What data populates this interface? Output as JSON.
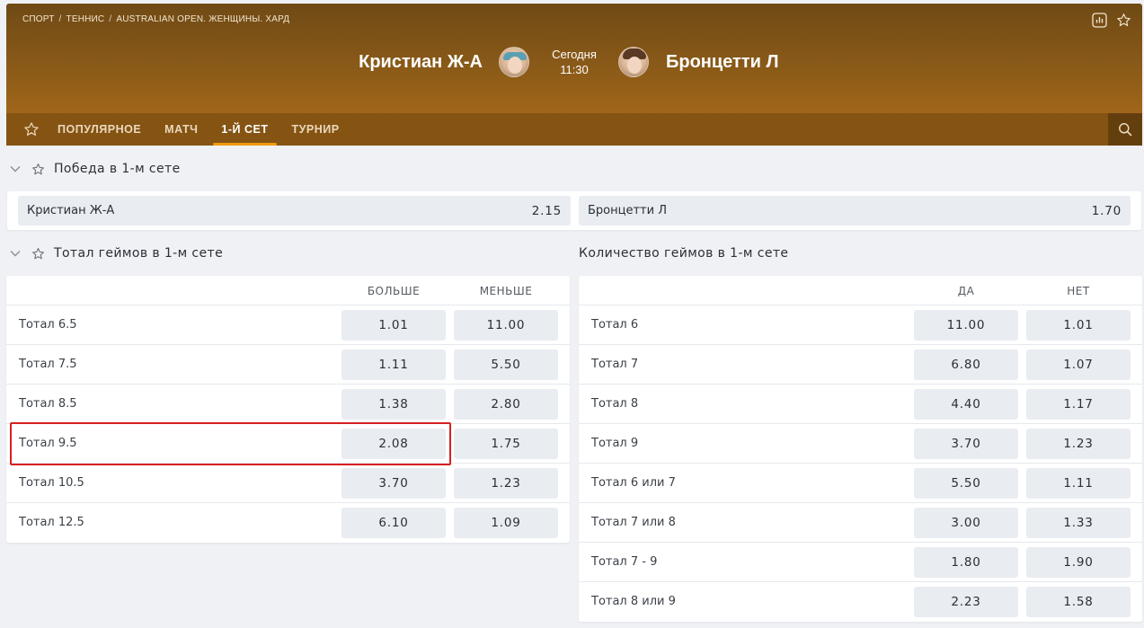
{
  "breadcrumb": [
    "СПОРТ",
    "ТЕННИС",
    "AUSTRALIAN OPEN. ЖЕНЩИНЫ. ХАРД"
  ],
  "breadcrumb_sep": "/",
  "header": {
    "team_left": "Кристиан Ж-А",
    "team_right": "Бронцетти Л",
    "day": "Сегодня",
    "time": "11:30",
    "icons": [
      "stats-icon",
      "star-icon"
    ]
  },
  "tabs": [
    {
      "label": "ПОПУЛЯРНОЕ",
      "active": false
    },
    {
      "label": "МАТЧ",
      "active": false
    },
    {
      "label": "1-Й СЕТ",
      "active": true
    },
    {
      "label": "ТУРНИР",
      "active": false
    }
  ],
  "winner_section": {
    "title": "Победа в 1-м сете",
    "options": [
      {
        "name": "Кристиан Ж-А",
        "odd": "2.15"
      },
      {
        "name": "Бронцетти Л",
        "odd": "1.70"
      }
    ]
  },
  "totals_section": {
    "title": "Тотал геймов в 1-м сете",
    "col_over": "БОЛЬШЕ",
    "col_under": "МЕНЬШЕ",
    "rows": [
      {
        "label": "Тотал 6.5",
        "over": "1.01",
        "under": "11.00"
      },
      {
        "label": "Тотал 7.5",
        "over": "1.11",
        "under": "5.50"
      },
      {
        "label": "Тотал 8.5",
        "over": "1.38",
        "under": "2.80"
      },
      {
        "label": "Тотал 9.5",
        "over": "2.08",
        "under": "1.75"
      },
      {
        "label": "Тотал 10.5",
        "over": "3.70",
        "under": "1.23"
      },
      {
        "label": "Тотал 12.5",
        "over": "6.10",
        "under": "1.09"
      }
    ]
  },
  "games_count_section": {
    "title": "Количество геймов в 1-м сете",
    "col_yes": "ДА",
    "col_no": "НЕТ",
    "rows": [
      {
        "label": "Тотал 6",
        "yes": "11.00",
        "no": "1.01"
      },
      {
        "label": "Тотал 7",
        "yes": "6.80",
        "no": "1.07"
      },
      {
        "label": "Тотал 8",
        "yes": "4.40",
        "no": "1.17"
      },
      {
        "label": "Тотал 9",
        "yes": "3.70",
        "no": "1.23"
      },
      {
        "label": "Тотал 6 или 7",
        "yes": "5.50",
        "no": "1.11"
      },
      {
        "label": "Тотал 7 или 8",
        "yes": "3.00",
        "no": "1.33"
      },
      {
        "label": "Тотал 7 - 9",
        "yes": "1.80",
        "no": "1.90"
      },
      {
        "label": "Тотал 8 или 9",
        "yes": "2.23",
        "no": "1.58"
      }
    ]
  },
  "colors": {
    "header_dark": "#6f4a15",
    "header_light": "#a2671a",
    "tab_active_underline": "#f39a0b",
    "highlight_box": "#d62020",
    "odd_button_bg": "#e9ecf1",
    "page_bg": "#eff1f5"
  }
}
